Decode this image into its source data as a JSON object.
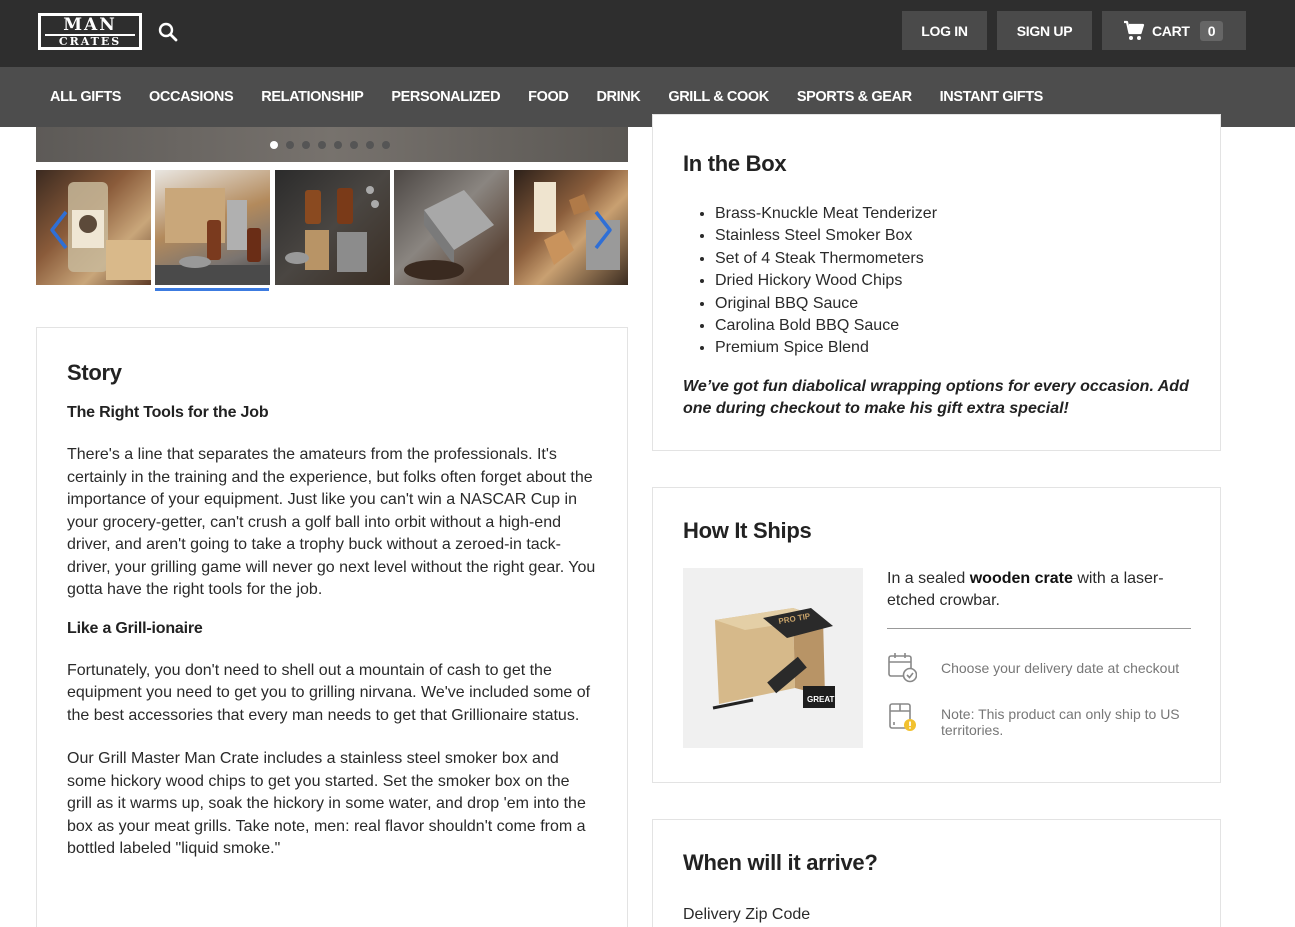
{
  "header": {
    "logo_line1": "MAN",
    "logo_line2": "CRATES",
    "search_icon": "search-icon",
    "login_label": "LOG IN",
    "signup_label": "SIGN UP",
    "cart_label": "CART",
    "cart_count": "0",
    "cart_icon": "cart-icon"
  },
  "nav": {
    "items": [
      "ALL GIFTS",
      "OCCASIONS",
      "RELATIONSHIP",
      "PERSONALIZED",
      "FOOD",
      "DRINK",
      "GRILL & COOK",
      "SPORTS & GEAR",
      "INSTANT GIFTS"
    ]
  },
  "gallery": {
    "dot_count": 8,
    "active_dot": 0,
    "thumbnail_count": 5,
    "selected_thumbnail": 1,
    "prev_icon": "chevron-left-icon",
    "next_icon": "chevron-right-icon"
  },
  "story": {
    "title": "Story",
    "h1": "The Right Tools for the Job",
    "p1": "There's a line that separates the amateurs from the professionals. It's certainly in the training and the experience, but folks often forget about the importance of your equipment. Just like you can't win a NASCAR Cup in your grocery-getter, can't crush a golf ball into orbit without a high-end driver, and aren't going to take a trophy buck without a zeroed-in tack-driver, your grilling game will never go next level without the right gear. You gotta have the right tools for the job.",
    "h2": "Like a Grill-ionaire",
    "p2": "Fortunately, you don't need to shell out a mountain of cash to get the equipment you need to get you to grilling nirvana. We've included some of the best accessories that every man needs to get that Grillionaire status.",
    "p3": "Our Grill Master Man Crate includes a stainless steel smoker box and some hickory wood chips to get you started. Set the smoker box on the grill as it warms up, soak the hickory in some water, and drop 'em into the box as your meat grills. Take note, men: real flavor shouldn't come from a bottled labeled \"liquid smoke.\""
  },
  "in_the_box": {
    "title": "In the Box",
    "items": [
      "Brass-Knuckle Meat Tenderizer",
      "Stainless Steel Smoker Box",
      "Set of 4 Steak Thermometers",
      "Dried Hickory Wood Chips",
      "Original BBQ Sauce",
      "Carolina Bold BBQ Sauce",
      "Premium Spice Blend"
    ],
    "note": "We’ve got fun diabolical wrapping options for every occasion. Add one during checkout to make his gift extra special!"
  },
  "how_it_ships": {
    "title": "How It Ships",
    "desc_pre": "In a sealed ",
    "desc_bold": "wooden crate",
    "desc_post": " with a laser-etched crowbar.",
    "crate_tag": "PRO TIP",
    "crate_card": "GREAT",
    "delivery_text": "Choose your delivery date at checkout",
    "delivery_icon": "calendar-check-icon",
    "note_text": "Note: This product can only ship to US territories.",
    "note_icon": "package-warning-icon"
  },
  "arrival": {
    "title": "When will it arrive?",
    "zip_label": "Delivery Zip Code"
  }
}
